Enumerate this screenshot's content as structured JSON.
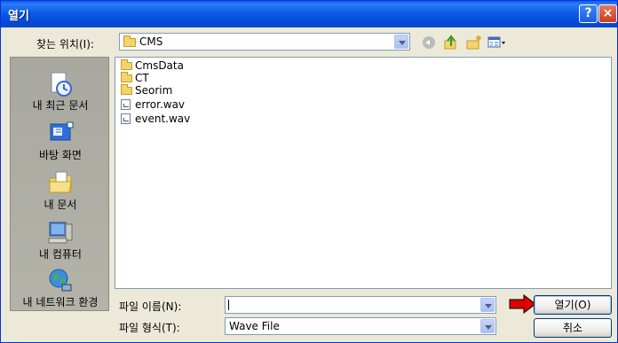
{
  "window": {
    "title": "열기",
    "help_glyph": "?",
    "close_glyph": "×"
  },
  "look_in": {
    "label": "찾는 위치(I):",
    "value": "CMS"
  },
  "places": [
    {
      "label": "내 최근 문서",
      "icon": "recent-documents-icon"
    },
    {
      "label": "바탕 화면",
      "icon": "desktop-icon"
    },
    {
      "label": "내 문서",
      "icon": "my-documents-icon"
    },
    {
      "label": "내 컴퓨터",
      "icon": "my-computer-icon"
    },
    {
      "label": "내 네트워크 환경",
      "icon": "network-icon"
    }
  ],
  "files": [
    {
      "name": "CmsData",
      "type": "folder"
    },
    {
      "name": "CT",
      "type": "folder"
    },
    {
      "name": "Seorim",
      "type": "folder"
    },
    {
      "name": "error.wav",
      "type": "wav"
    },
    {
      "name": "event.wav",
      "type": "wav"
    }
  ],
  "file_name": {
    "label": "파일 이름(N):",
    "value": ""
  },
  "file_type": {
    "label": "파일 형식(T):",
    "value": "Wave File"
  },
  "buttons": {
    "open": "열기(O)",
    "cancel": "취소"
  },
  "colors": {
    "titlebar": "#0A5FF0",
    "places_bar": "#A8A8A0",
    "annotation_arrow": "#E00000"
  }
}
